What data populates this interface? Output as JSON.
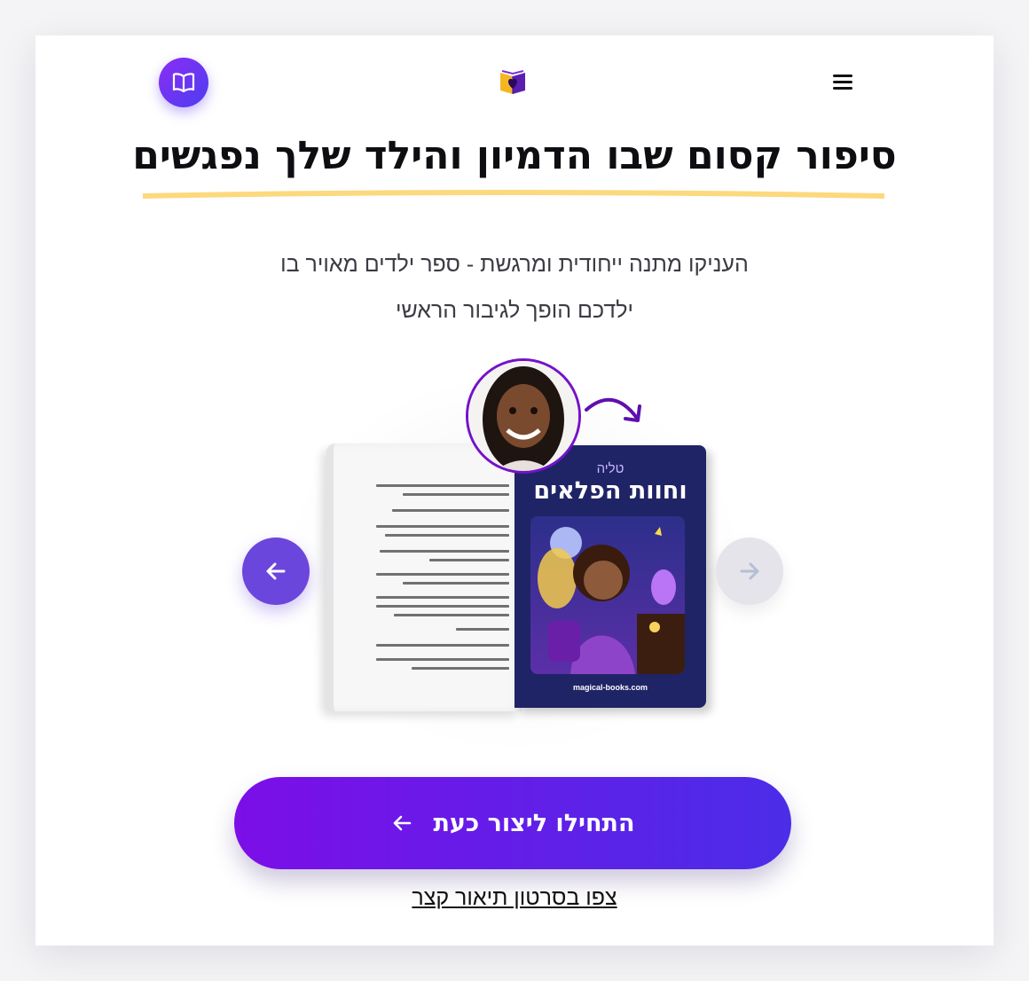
{
  "header": {
    "menu_icon": "hamburger-menu-icon",
    "logo_icon": "book-heart-logo",
    "book_button_icon": "open-book-icon"
  },
  "hero": {
    "title": "סיפור קסום שבו הדמיון והילד שלך נפגשים",
    "subtitle_line1": "העניקו מתנה ייחודית ומרגשת - ספר ילדים מאויר בו",
    "subtitle_line2": "ילדכם הופך לגיבור הראשי"
  },
  "book_preview": {
    "cover_name": "טליה",
    "cover_title": "וחוות הפלאים",
    "cover_site": "magical-books.com"
  },
  "carousel": {
    "prev_icon": "arrow-left-icon",
    "next_icon": "arrow-right-icon"
  },
  "cta": {
    "label": "התחילו ליצור כעת",
    "icon": "arrow-left-icon"
  },
  "video_link": "צפו בסרטון תיאור קצר",
  "colors": {
    "primary": "#7412c9",
    "gradient_end": "#4b2de8",
    "highlight": "#fcd97e",
    "cover_bg": "#1f2466"
  }
}
